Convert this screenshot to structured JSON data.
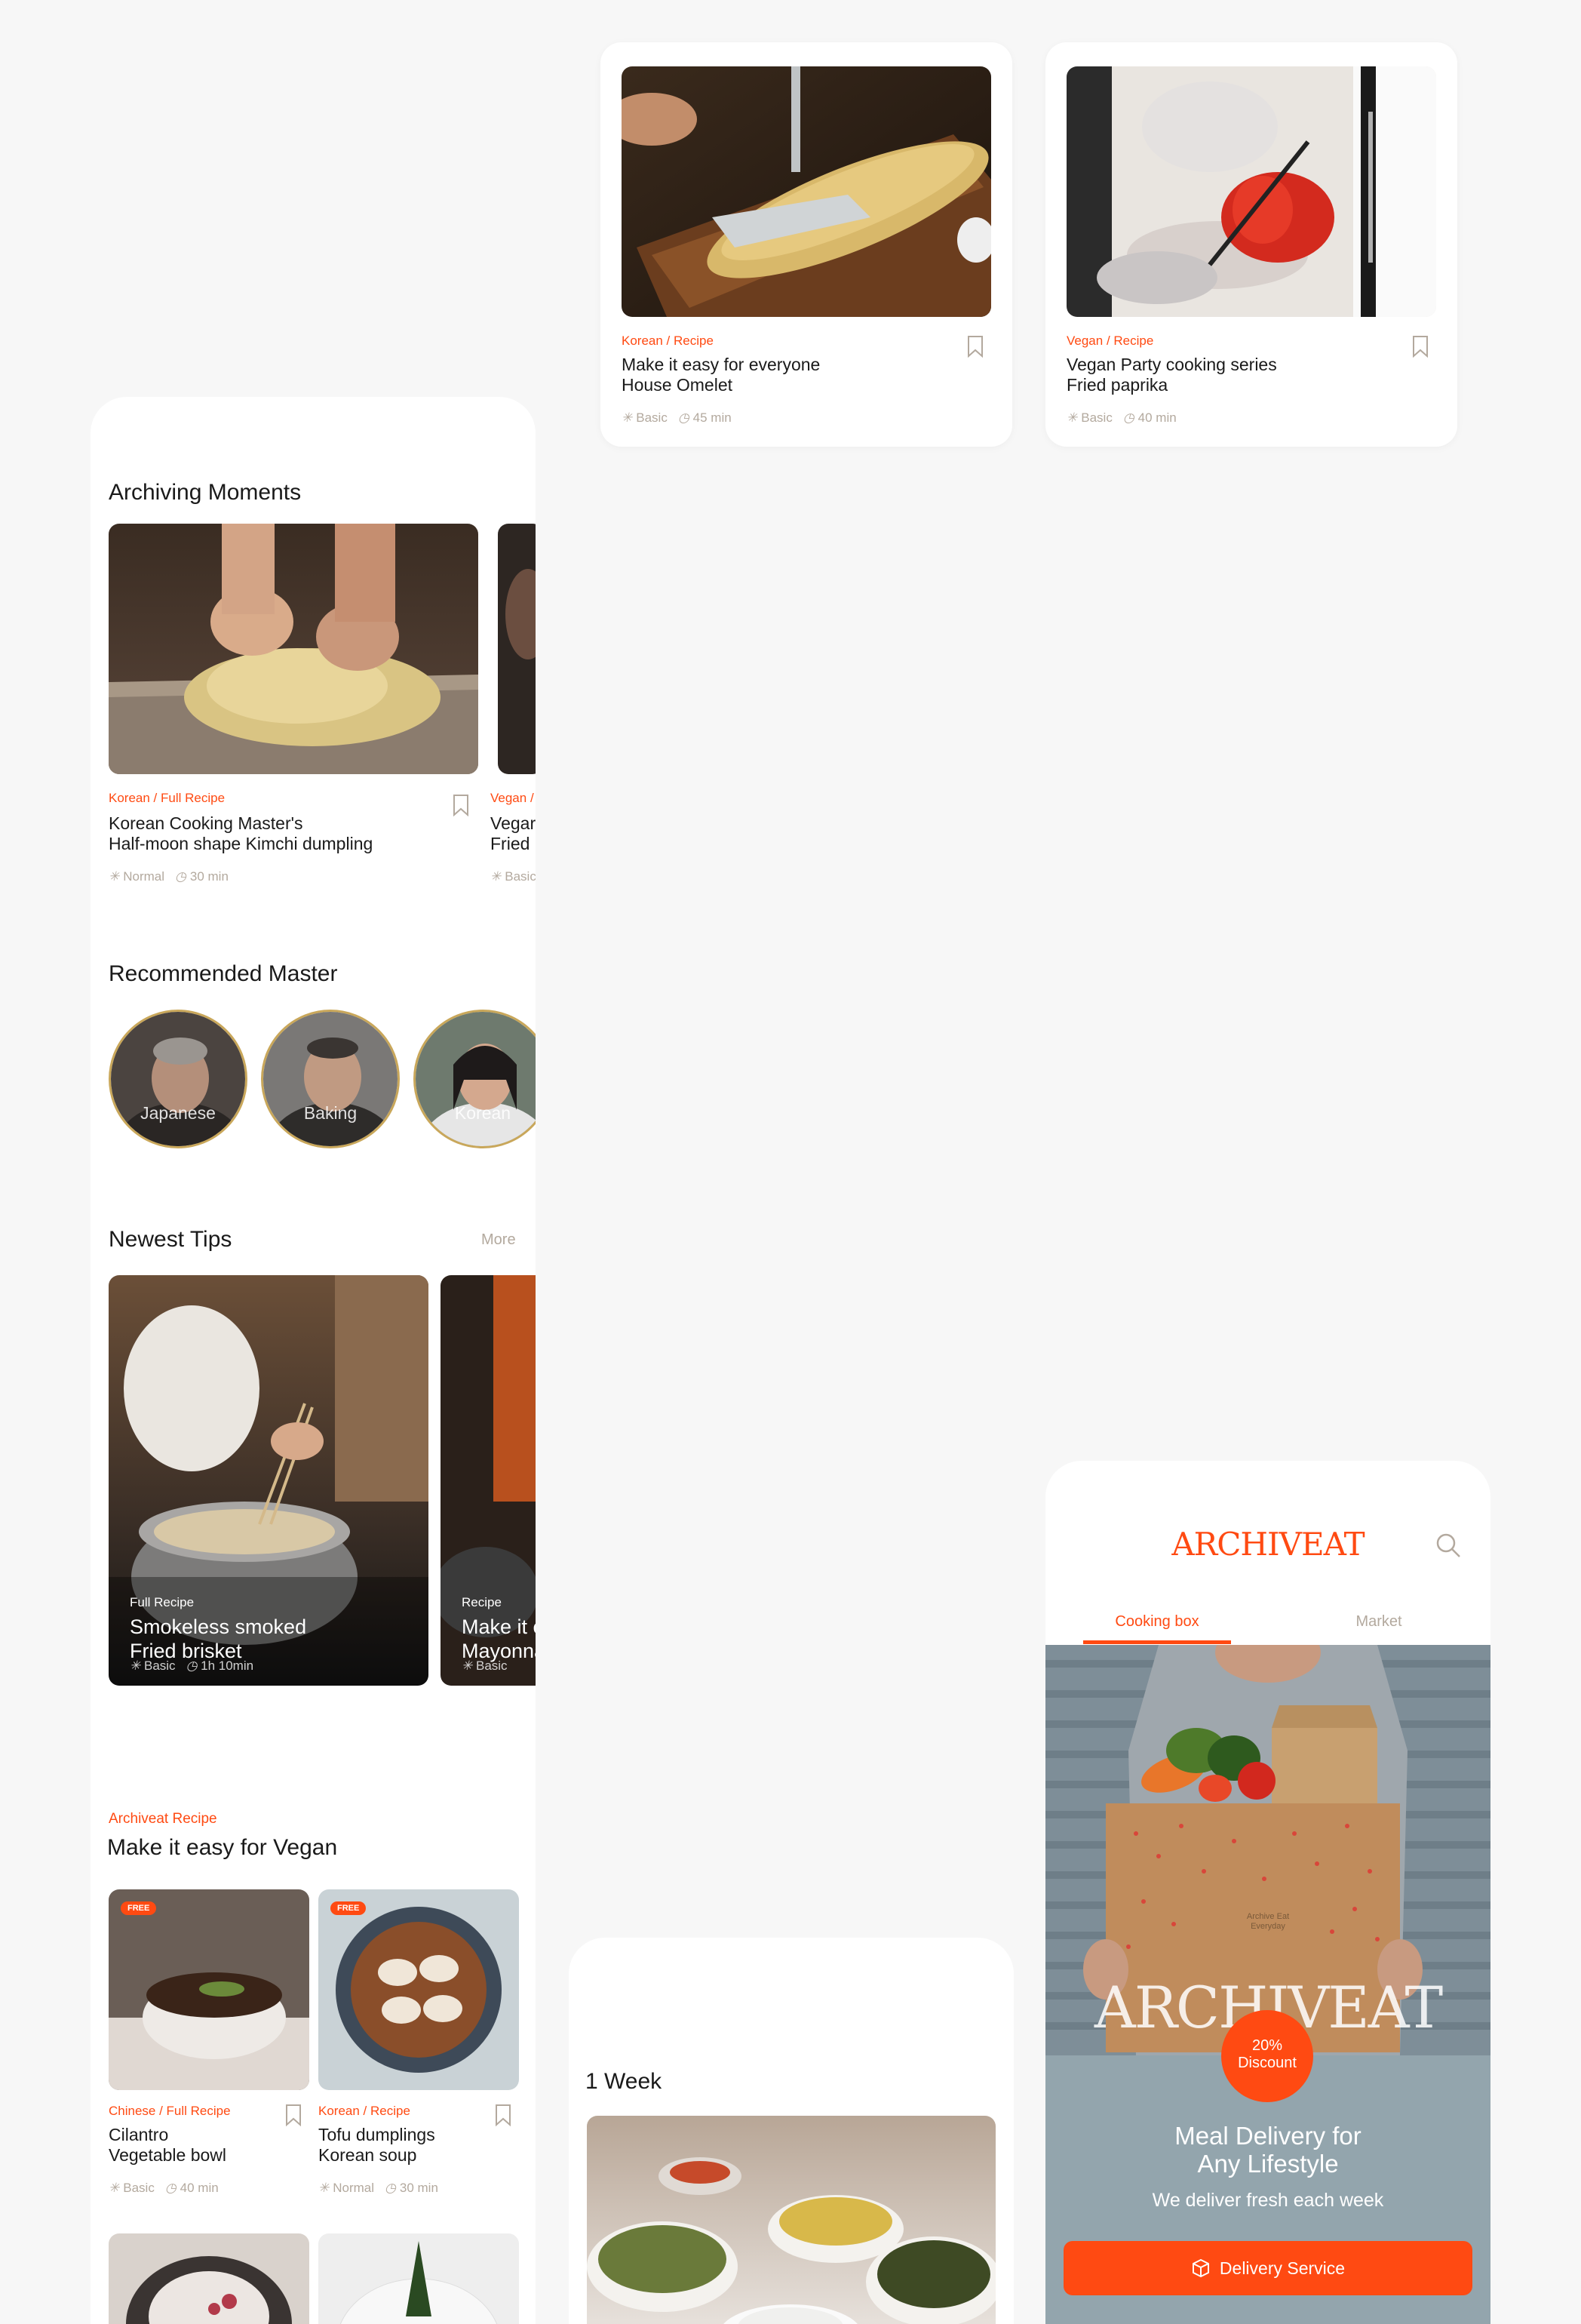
{
  "top_cards": [
    {
      "category": "Korean / Recipe",
      "title_line1": "Make it easy for everyone",
      "title_line2": "House Omelet",
      "level": "Basic",
      "time": "45 min"
    },
    {
      "category": "Vegan / Recipe",
      "title_line1": "Vegan Party cooking series",
      "title_line2": "Fried paprika",
      "level": "Basic",
      "time": "40 min"
    }
  ],
  "archiving": {
    "heading": "Archiving Moments",
    "card": {
      "category": "Korean / Full Recipe",
      "title_line1": "Korean Cooking Master's",
      "title_line2": "Half-moon shape Kimchi dumpling",
      "level": "Normal",
      "time": "30 min"
    },
    "peek": {
      "category": "Vegan /",
      "title_line1": "Vegar",
      "title_line2": "Fried p",
      "level": "Basic"
    }
  },
  "masters": {
    "heading": "Recommended Master",
    "items": [
      {
        "label": "Japanese"
      },
      {
        "label": "Baking"
      },
      {
        "label": "Korean"
      }
    ]
  },
  "tips": {
    "heading": "Newest Tips",
    "more": "More",
    "card": {
      "category": "Full Recipe",
      "title_line1": "Smokeless smoked",
      "title_line2": "Fried brisket",
      "level": "Basic",
      "time": "1h 10min"
    },
    "peek": {
      "category": "Recipe",
      "title_line1": "Make it e",
      "title_line2": "Mayonna",
      "level": "Basic"
    }
  },
  "vegan": {
    "eyebrow": "Archiveat Recipe",
    "heading": "Make it easy for Vegan",
    "badge": "FREE",
    "items": [
      {
        "category": "Chinese / Full Recipe",
        "title_line1": "Cilantro",
        "title_line2": "Vegetable bowl",
        "level": "Basic",
        "time": "40 min"
      },
      {
        "category": "Korean / Recipe",
        "title_line1": "Tofu dumplings",
        "title_line2": "Korean soup",
        "level": "Normal",
        "time": "30 min"
      }
    ]
  },
  "week": {
    "heading": "1 Week"
  },
  "app": {
    "logo": "ARCHIVEAT",
    "tabs": [
      "Cooking box",
      "Market"
    ],
    "box_small_text_1": "Archive Eat",
    "box_small_text_2": "Everyday",
    "box_logo": "ARCHIVEAT",
    "discount_1": "20%",
    "discount_2": "Discount",
    "headline_1": "Meal Delivery for",
    "headline_2": "Any Lifestyle",
    "sub": "We deliver fresh each week",
    "cta": "Delivery Service"
  },
  "colors": {
    "accent": "#ff4a12",
    "muted": "#b3a99e",
    "banner": "#93a5ad"
  }
}
